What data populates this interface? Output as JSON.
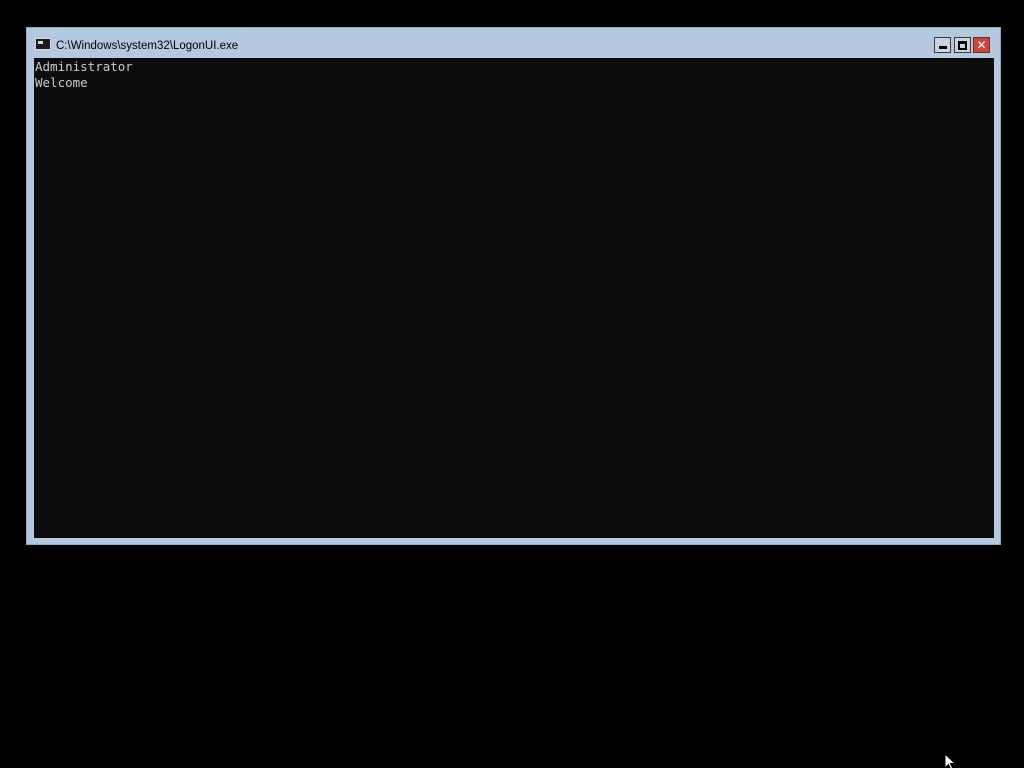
{
  "window": {
    "title": "C:\\Windows\\system32\\LogonUI.exe",
    "icon": "console-icon",
    "controls": {
      "minimize_icon": "minimize-icon",
      "maximize_icon": "maximize-icon",
      "close_icon": "close-icon",
      "close_glyph": "✕"
    }
  },
  "console": {
    "lines": [
      "Administrator",
      "Welcome"
    ],
    "background": "#0c0c0c",
    "foreground": "#cccccc"
  },
  "colors": {
    "desktop": "#000000",
    "window_frame": "#b4c8e0",
    "close_button": "#c9463d"
  },
  "cursor": {
    "icon": "mouse-pointer-icon"
  }
}
